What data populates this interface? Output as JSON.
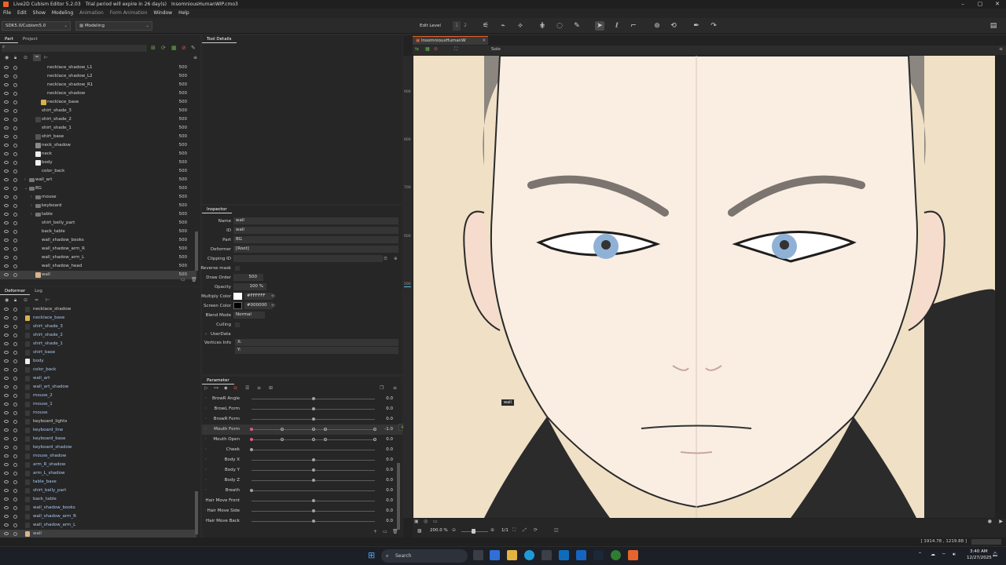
{
  "titlebar": {
    "app": "Live2D Cubism Editor 5.2.03",
    "trial": "Trial period will expire in 26 day(s)",
    "file": "InsomniousHumanWIP.cmo3"
  },
  "menu": [
    "File",
    "Edit",
    "Show",
    "Modeling",
    "Animation",
    "Form Animation",
    "Window",
    "Help"
  ],
  "toolbar": {
    "sdk": "SDK5.0/Cubism5.0",
    "mode": "Modeling",
    "edit_level_label": "Edit Level",
    "edit_levels": [
      "1",
      "2",
      "3"
    ]
  },
  "part_panel": {
    "tabs": [
      "Part",
      "Project"
    ],
    "rows": [
      {
        "label": "necklace_shadow_L1",
        "value": "500",
        "indent": 60
      },
      {
        "label": "necklace_shadow_L2",
        "value": "500",
        "indent": 60
      },
      {
        "label": "necklace_shadow_R1",
        "value": "500",
        "indent": 60
      },
      {
        "label": "necklace_shadow",
        "value": "500",
        "indent": 60
      },
      {
        "label": "necklace_base",
        "value": "500",
        "indent": 60
      },
      {
        "label": "shirt_shade_3",
        "value": "500",
        "indent": 53
      },
      {
        "label": "shirt_shade_2",
        "value": "500",
        "indent": 53
      },
      {
        "label": "shirt_shade_1",
        "value": "500",
        "indent": 53
      },
      {
        "label": "shirt_base",
        "value": "500",
        "indent": 53
      },
      {
        "label": "neck_shadow",
        "value": "500",
        "indent": 53
      },
      {
        "label": "neck",
        "value": "500",
        "indent": 53
      },
      {
        "label": "body",
        "value": "500",
        "indent": 53
      },
      {
        "label": "color_back",
        "value": "500",
        "indent": 53
      },
      {
        "label": "wall_art",
        "value": "500",
        "indent": 45
      },
      {
        "label": "BG",
        "value": "500",
        "indent": 45
      },
      {
        "label": "mouse",
        "value": "500",
        "indent": 53
      },
      {
        "label": "keyboard",
        "value": "500",
        "indent": 53
      },
      {
        "label": "table",
        "value": "500",
        "indent": 53
      },
      {
        "label": "shirt_belly_part",
        "value": "500",
        "indent": 53
      },
      {
        "label": "back_table",
        "value": "500",
        "indent": 53
      },
      {
        "label": "wall_shadow_books",
        "value": "500",
        "indent": 53
      },
      {
        "label": "wall_shadow_arm_R",
        "value": "500",
        "indent": 53
      },
      {
        "label": "wall_shadow_arm_L",
        "value": "500",
        "indent": 53
      },
      {
        "label": "wall_shadow_head",
        "value": "500",
        "indent": 53
      },
      {
        "label": "wall",
        "value": "500",
        "indent": 53
      }
    ]
  },
  "deformer_panel": {
    "tabs": [
      "Deformer",
      "Log"
    ],
    "rows": [
      "necklace_shadow",
      "necklace_base",
      "shirt_shade_3",
      "shirt_shade_2",
      "shirt_shade_1",
      "shirt_base",
      "body",
      "color_back",
      "wall_art",
      "wall_art_shadow",
      "mouse_2",
      "mouse_1",
      "mouse",
      "keyboard_lights",
      "keyboard_line",
      "keyboard_base",
      "keyboard_shadow",
      "mouse_shadow",
      "arm_R_shadow",
      "arm_L_shadow",
      "table_base",
      "shirt_belly_part",
      "back_table",
      "wall_shadow_books",
      "wall_shadow_arm_R",
      "wall_shadow_arm_L",
      "wall"
    ]
  },
  "tool_details": {
    "title": "Tool Details"
  },
  "inspector": {
    "title": "Inspector",
    "name_label": "Name",
    "name": "wall",
    "id_label": "ID",
    "id": "wall",
    "part_label": "Part",
    "part": "BG",
    "deformer_label": "Deformer",
    "deformer": "[Root]",
    "clipping_label": "Clipping ID",
    "reverse_mask_label": "Reverse mask",
    "draw_order_label": "Draw Order",
    "draw_order": "500",
    "opacity_label": "Opacity",
    "opacity": "100 %",
    "multiply_label": "Multiply Color",
    "multiply": "#FFFFFF",
    "screen_label": "Screen Color",
    "screen": "#000000",
    "blend_label": "Blend Mode",
    "blend": "Normal",
    "culling_label": "Culling",
    "userdata_label": "UserData",
    "vertices_label": "Vertices Info",
    "vx": "X:",
    "vy": "Y:"
  },
  "parameter": {
    "title": "Parameter",
    "rows": [
      {
        "name": "BrowR Angle",
        "value": "0.0",
        "pos": 0.5
      },
      {
        "name": "BrowL Form",
        "value": "0.0",
        "pos": 0.5
      },
      {
        "name": "BrowR Form",
        "value": "0.0",
        "pos": 0.5
      },
      {
        "name": "Mouth Form",
        "value": "-1.0",
        "pos": 0.0
      },
      {
        "name": "Mouth Open",
        "value": "0.0",
        "pos": 0.0
      },
      {
        "name": "Cheek",
        "value": "0.0",
        "pos": 0.0
      },
      {
        "name": "Body X",
        "value": "0.0",
        "pos": 0.5
      },
      {
        "name": "Body Y",
        "value": "0.0",
        "pos": 0.5
      },
      {
        "name": "Body Z",
        "value": "0.0",
        "pos": 0.5
      },
      {
        "name": "Breath",
        "value": "0.0",
        "pos": 0.0
      },
      {
        "name": "Hair Move Front",
        "value": "0.0",
        "pos": 0.5
      },
      {
        "name": "Hair Move Side",
        "value": "0.0",
        "pos": 0.5
      },
      {
        "name": "Hair Move Back",
        "value": "0.0",
        "pos": 0.5
      }
    ]
  },
  "viewport": {
    "tab": "InsomniousHumanW",
    "solo": "Solo",
    "ruler": [
      "900",
      "800",
      "700",
      "600",
      "500"
    ],
    "tooltip": "wall",
    "zoom": "200.0 %",
    "ratio": "1/1"
  },
  "status": {
    "coords": "[ 1914.78 , 1219.88 ]"
  },
  "taskbar": {
    "search": "Search",
    "time": "3:40 AM",
    "date": "12/27/2025"
  }
}
